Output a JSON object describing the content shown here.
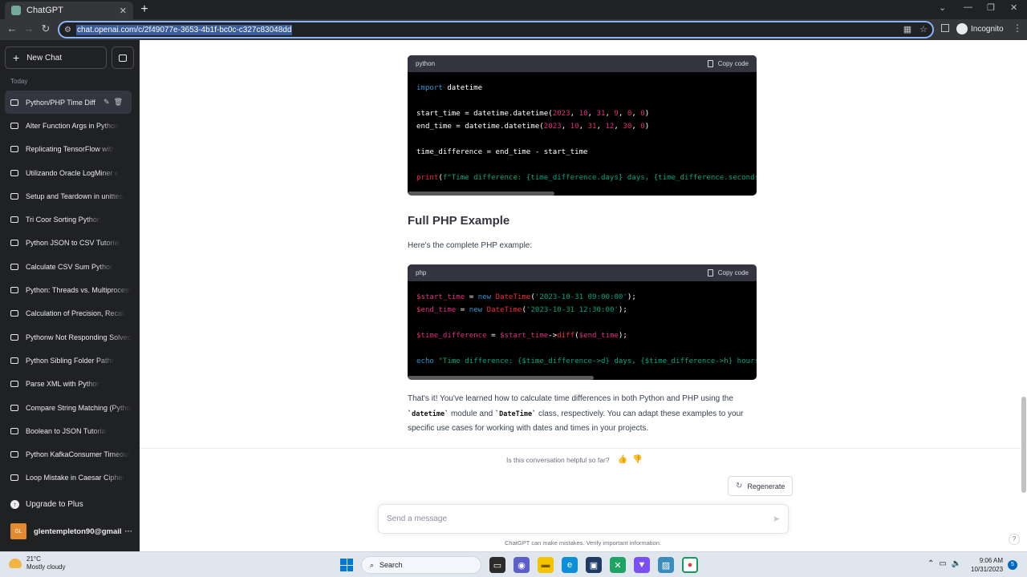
{
  "browser": {
    "tab_title": "ChatGPT",
    "tab_close": "✕",
    "new_tab": "+",
    "url": "chat.openai.com/c/2f49077e-3653-4b1f-bc0c-c327c83048dd",
    "incognito_label": "Incognito",
    "win_min": "⌄",
    "win_minimize": "—",
    "win_restore": "❐",
    "win_close": "✕"
  },
  "sidebar": {
    "new_chat_label": "New Chat",
    "section_label": "Today",
    "items": [
      {
        "label": "Python/PHP Time Diff"
      },
      {
        "label": "Alter Function Args in Python"
      },
      {
        "label": "Replicating TensorFlow with"
      },
      {
        "label": "Utilizando Oracle LogMiner e"
      },
      {
        "label": "Setup and Teardown in unittest"
      },
      {
        "label": "Tri Coor Sorting Python"
      },
      {
        "label": "Python JSON to CSV Tutorial"
      },
      {
        "label": "Calculate CSV Sum Python"
      },
      {
        "label": "Python: Threads vs. Multiprocessing"
      },
      {
        "label": "Calculation of Precision, Recall"
      },
      {
        "label": "Pythonw Not Responding Solved"
      },
      {
        "label": "Python Sibling Folder Paths"
      },
      {
        "label": "Parse XML with Python"
      },
      {
        "label": "Compare String Matching (Python)"
      },
      {
        "label": "Boolean to JSON Tutorial"
      },
      {
        "label": "Python KafkaConsumer Timeout"
      },
      {
        "label": "Loop Mistake in Caesar Cipher"
      }
    ],
    "upgrade_label": "Upgrade to Plus",
    "user_initials": "GL",
    "user_email": "glentempleton90@gmail"
  },
  "main": {
    "python_block": {
      "lang": "python",
      "copy_label": "Copy code"
    },
    "php_heading": "Full PHP Example",
    "php_intro": "Here's the complete PHP example:",
    "php_block": {
      "lang": "php",
      "copy_label": "Copy code"
    },
    "outro_1": "That's it! You've learned how to calculate time differences in both Python and PHP using the",
    "outro_code1": "`datetime`",
    "outro_2": " module and ",
    "outro_code2": "`DateTime`",
    "outro_3": " class, respectively. You can adapt these examples to your specific use cases for working with dates and times in your projects.",
    "feedback_question": "Is this conversation helpful so far?",
    "regenerate_label": "Regenerate",
    "composer_placeholder": "Send a message",
    "disclaimer": "ChatGPT can make mistakes. Verify important information.",
    "help_label": "?"
  },
  "taskbar": {
    "temperature": "21°C",
    "weather": "Mostly cloudy",
    "search_label": "Search",
    "time": "9:06 AM",
    "date": "10/31/2023",
    "notifications": "5"
  },
  "colors": {
    "sidebar_bg": "#202123",
    "code_bg": "#000000",
    "keyword": "#2e95d3",
    "number": "#df3079",
    "string": "#00a67d"
  }
}
